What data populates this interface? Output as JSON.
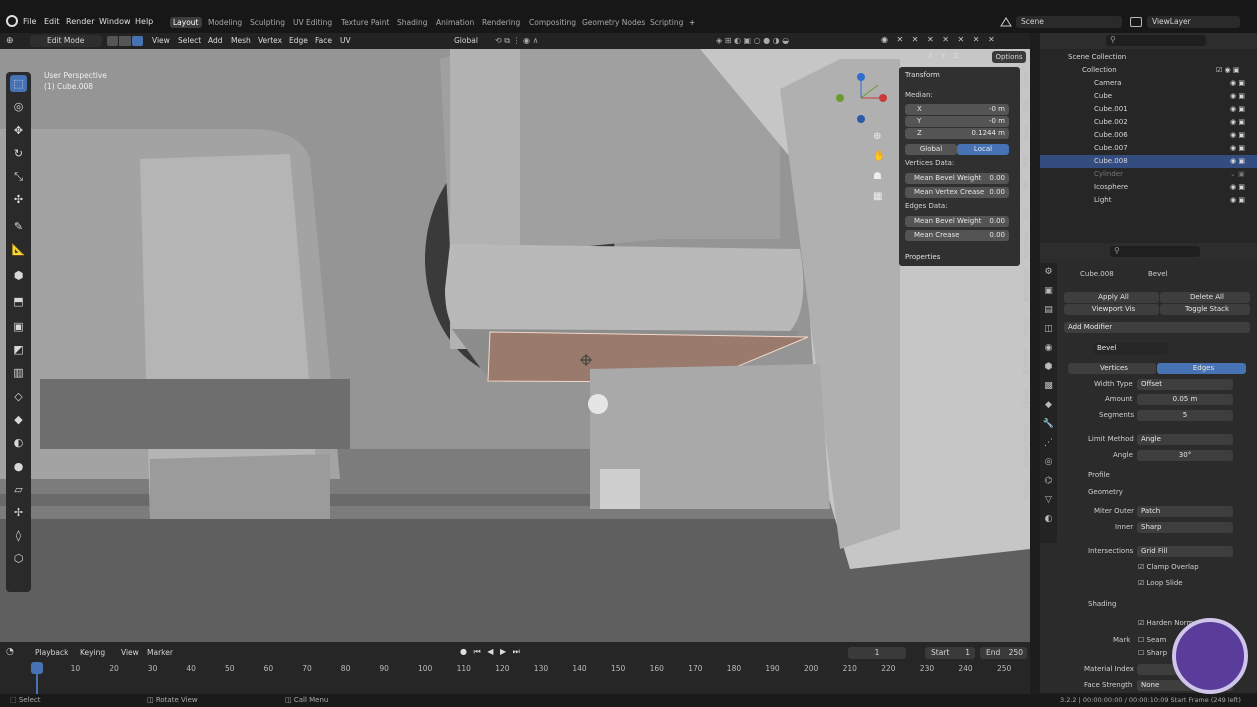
{
  "menus": [
    "File",
    "Edit",
    "Render",
    "Window",
    "Help"
  ],
  "workspaces": [
    "Layout",
    "Modeling",
    "Sculpting",
    "UV Editing",
    "Texture Paint",
    "Shading",
    "Animation",
    "Rendering",
    "Compositing",
    "Geometry Nodes",
    "Scripting",
    "+"
  ],
  "scene": "Scene",
  "view_layer": "ViewLayer",
  "header": {
    "mode": "Edit Mode",
    "items": [
      "View",
      "Select",
      "Add",
      "Mesh",
      "Vertex",
      "Edge",
      "Face",
      "UV"
    ],
    "orientation": "Global",
    "options": "Options",
    "axes": [
      "X",
      "Y",
      "Z"
    ]
  },
  "viewport": {
    "view_name": "User Perspective",
    "object": "(1) Cube.008"
  },
  "npanel": {
    "transform": "Transform",
    "median": "Median:",
    "x_label": "X",
    "x_val": "-0 m",
    "y_label": "Y",
    "y_val": "-0 m",
    "z_label": "Z",
    "z_val": "0.1244 m",
    "global": "Global",
    "local": "Local",
    "vertices_data": "Vertices Data:",
    "mean_bevel_weight_v": "Mean Bevel Weight",
    "mbw_v_val": "0.00",
    "mean_vertex_crease": "Mean Vertex Crease",
    "mvc_val": "0.00",
    "edges_data": "Edges Data:",
    "mean_bevel_weight_e": "Mean Bevel Weight",
    "mbw_e_val": "0.00",
    "mean_crease": "Mean Crease",
    "mc_val": "0.00",
    "properties": "Properties"
  },
  "side_tabs": [
    "Item",
    "Tool",
    "View",
    "PDT",
    "VR",
    "Edit",
    "Animate",
    "Animation",
    "Paper",
    "3D-Print",
    "Tissue",
    "Grease Pencil",
    "Rigify"
  ],
  "outliner": {
    "root": "Scene Collection",
    "collection": "Collection",
    "items": [
      "Camera",
      "Cube",
      "Cube.001",
      "Cube.002",
      "Cube.006",
      "Cube.007",
      "Cube.008",
      "Cylinder",
      "Icosphere",
      "Light"
    ]
  },
  "props": {
    "object": "Cube.008",
    "modifier_breadcrumb": "Bevel",
    "apply_all": "Apply All",
    "delete_all": "Delete All",
    "viewport_vis": "Viewport Vis",
    "toggle_stack": "Toggle Stack",
    "add_modifier": "Add Modifier",
    "modifier_name": "Bevel",
    "vertices": "Vertices",
    "edges": "Edges",
    "width_type_label": "Width Type",
    "width_type": "Offset",
    "amount_label": "Amount",
    "amount": "0.05 m",
    "segments_label": "Segments",
    "segments": "5",
    "limit_method_label": "Limit Method",
    "limit_method": "Angle",
    "angle_label": "Angle",
    "angle": "30°",
    "profile": "Profile",
    "geometry": "Geometry",
    "miter_outer_label": "Miter Outer",
    "miter_outer": "Patch",
    "inner_label": "Inner",
    "inner": "Sharp",
    "intersections_label": "Intersections",
    "intersections": "Grid Fill",
    "clamp_overlap": "Clamp Overlap",
    "loop_slide": "Loop Slide",
    "shading": "Shading",
    "harden_normals": "Harden Norm",
    "mark_label": "Mark",
    "seam": "Seam",
    "sharp": "Sharp",
    "material_index_label": "Material Index",
    "face_strength_label": "Face Strength",
    "face_strength": "None"
  },
  "timeline": {
    "items": [
      "Playback",
      "Keying",
      "View",
      "Marker"
    ],
    "current": "1",
    "start_label": "Start",
    "start": "1",
    "end_label": "End",
    "end": "250",
    "ticks": [
      "1",
      "10",
      "20",
      "30",
      "40",
      "50",
      "60",
      "70",
      "80",
      "90",
      "100",
      "110",
      "120",
      "130",
      "140",
      "150",
      "160",
      "170",
      "180",
      "190",
      "200",
      "210",
      "220",
      "230",
      "240",
      "250"
    ]
  },
  "status": {
    "select": "Select",
    "rotate": "Rotate View",
    "call_menu": "Call Menu",
    "info": "3.2.2 | 00:00:00:00 / 00:00:10:09 Start Frame (249 left)"
  }
}
